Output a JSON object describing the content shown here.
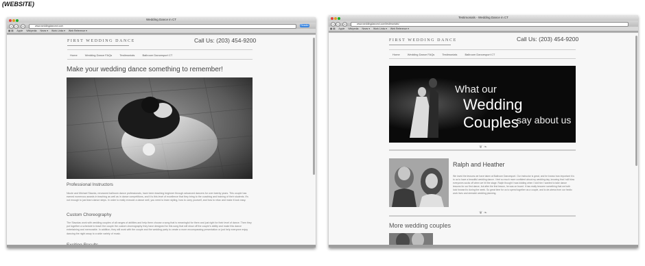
{
  "caption": "(WEBSITE)",
  "browser": {
    "bookmarks": [
      "Apple",
      "Wikipedia",
      "News ▾",
      "Work Links ▾",
      "Web Reference ▾"
    ],
    "reader_label": "Reader",
    "colors": {
      "close": "#e0443e",
      "minimize": "#dea123",
      "zoom": "#1aab29"
    }
  },
  "window1": {
    "title": "Wedding Dance in CT",
    "url": "www.weddingdancect.com",
    "logo": "FIRST WEDDING DANCE",
    "phone": "Call Us: (203) 454-9200",
    "menu": [
      "Home",
      "Wedding Dance FAQs",
      "Testimonials",
      "Ballroom Dancesport CT"
    ],
    "headline": "Make your wedding dance something to remember!",
    "sections": [
      {
        "heading": "Professional Instructors",
        "text": "Nicole and Michael Stavola, renowned ballroom dance professionals, have been teaching beginner through advanced dancers for over twenty years. This couple has earned numerous awards in teaching as well as in dance competitions, and it is this level of excellence that they bring to the coaching and training of their students. It's not enough to just learn dance steps. In order to really execute a dance well, you need to learn styling, how to carry yourself, and how to relax and make it look easy."
      },
      {
        "heading": "Custom Choreography",
        "text": "The Stavolas work with wedding couples of all ranges of abilities and help them choose a song that is meaningful for them and just right for their level of dance. Then they put together a schedule to teach the couple the custom choreography they have designed for this song that will show off the couple's ability and make this dance entertaining and memorable. In addition, they will work with the couple and the wedding party to create a more encompassing presentation or just help everyone enjoy dancing the night away to a wide variety of music."
      },
      {
        "heading": "Exciting Results",
        "text": ""
      }
    ]
  },
  "window2": {
    "title": "Testimonials - Wedding Dance in CT",
    "url": "www.weddingdancect.com/testimonials/",
    "logo": "FIRST WEDDING DANCE",
    "phone": "Call Us: (203) 454-9200",
    "menu": [
      "Home",
      "Wedding Dance FAQs",
      "Testimonials",
      "Ballroom Dancesport CT"
    ],
    "banner": {
      "line1": "What our",
      "line2": "Wedding Couples",
      "line3": "say about us"
    },
    "ornament": "❦ ❧",
    "testimonial": {
      "name": "Ralph and Heather",
      "text": "We loved the lessons we have taken at Ballroom Dancesport. Our instructor is great, and he knows how important it is to us to have a beautiful wedding dance. I feel so much more confident about my wedding day, knowing that I will blow everyones socks off when we hit the stage. Ralph thought I was kidding when I told him I wanted to take dance lessons for our first dance, but after the first lesson, he was on board. It has really become something that we both look forward to during the week. So great time for us to spend together as a couple, and to de-stress from our hectic work lives and stressful wedding planning."
    },
    "more_heading": "More wedding couples"
  }
}
